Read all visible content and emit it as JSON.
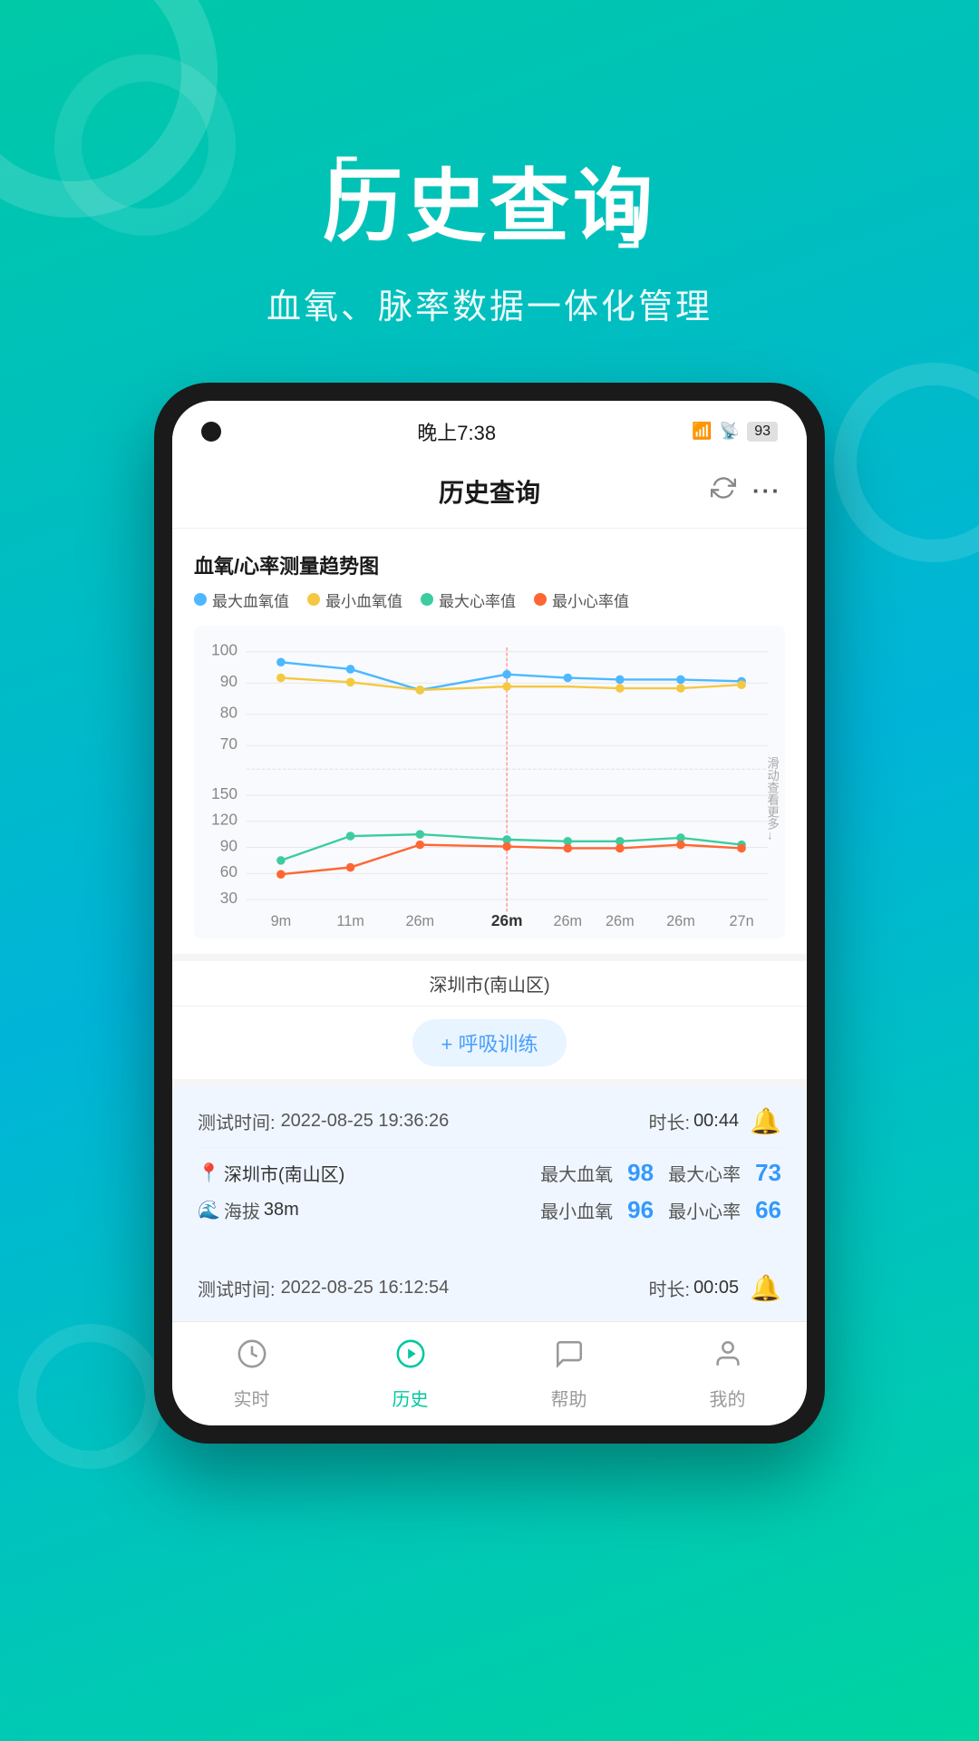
{
  "background": {
    "gradient_start": "#00c9a7",
    "gradient_end": "#00b4d8"
  },
  "header": {
    "title": "历史查询",
    "subtitle": "血氧、脉率数据一体化管理",
    "title_quote_open": "「",
    "title_quote_close": "」"
  },
  "status_bar": {
    "time": "晚上7:38",
    "camera_dot": true
  },
  "app_bar": {
    "title": "历史查询",
    "refresh_icon": "↻",
    "more_icon": "···"
  },
  "chart": {
    "title": "血氧/心率测量趋势图",
    "legend": [
      {
        "label": "最大血氧值",
        "color": "#4db8ff"
      },
      {
        "label": "最小血氧值",
        "color": "#f5c842"
      },
      {
        "label": "最大心率值",
        "color": "#3dcca0"
      },
      {
        "label": "最小心率值",
        "color": "#ff6633"
      }
    ],
    "y_axis_top": [
      "100",
      "90",
      "80",
      "70"
    ],
    "y_axis_bottom": [
      "150",
      "120",
      "90",
      "60",
      "30"
    ],
    "x_axis": [
      "9m",
      "11m",
      "26m",
      "26m",
      "26m",
      "26m",
      "26m",
      "27n"
    ],
    "selected_x": "26m",
    "scroll_hint": "滑动查看更多"
  },
  "location": {
    "city": "深圳市(南山区)"
  },
  "breathing_btn": {
    "label": "+ 呼吸训练"
  },
  "records": [
    {
      "test_time_label": "测试时间:",
      "test_time": "2022-08-25 19:36:26",
      "duration_label": "时长:",
      "duration": "00:44",
      "bell_emoji": "🔔",
      "location_icon": "📍",
      "location": "深圳市(南山区)",
      "max_spo2_label": "最大血氧",
      "max_spo2": "98",
      "max_hr_label": "最大心率",
      "max_hr": "73",
      "altitude_icon": "🌊",
      "altitude_label": "海拔",
      "altitude_value": "38m",
      "min_spo2_label": "最小血氧",
      "min_spo2": "96",
      "min_hr_label": "最小心率",
      "min_hr": "66"
    },
    {
      "test_time_label": "测试时间:",
      "test_time": "2022-08-25 16:12:54",
      "duration_label": "时长:",
      "duration": "00:05",
      "bell_emoji": "🔔"
    }
  ],
  "nav": {
    "items": [
      {
        "label": "实时",
        "icon": "clock",
        "active": false
      },
      {
        "label": "历史",
        "icon": "play",
        "active": true
      },
      {
        "label": "帮助",
        "icon": "chat",
        "active": false
      },
      {
        "label": "我的",
        "icon": "person",
        "active": false
      }
    ]
  }
}
